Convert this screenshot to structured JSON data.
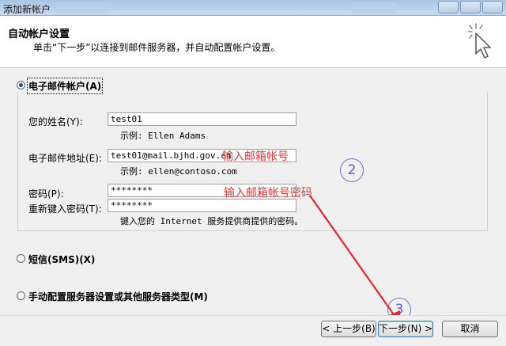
{
  "window": {
    "title": "添加新帐户"
  },
  "header": {
    "title": "自动帐户设置",
    "subtitle": "单击“下一步”以连接到邮件服务器，并自动配置帐户设置。"
  },
  "options": {
    "email": {
      "label": "电子邮件帐户(A)",
      "selected": true
    },
    "sms": {
      "label": "短信(SMS)(X)",
      "selected": false
    },
    "manual": {
      "label": "手动配置服务器设置或其他服务器类型(M)",
      "selected": false
    }
  },
  "form": {
    "name_label": "您的姓名(Y):",
    "name_value": "test01",
    "name_hint": "示例: Ellen Adams",
    "email_label": "电子邮件地址(E):",
    "email_value": "test01@mail.bjhd.gov.cn",
    "email_hint": "示例: ellen@contoso.com",
    "password_label": "密码(P):",
    "password_value": "********",
    "retype_label": "重新键入密码(T):",
    "retype_value": "********",
    "password_hint": "键入您的 Internet 服务提供商提供的密码。"
  },
  "annotations": {
    "email_note": "输入邮箱帐号",
    "password_note": "输入邮箱帐号密码",
    "step2": "2",
    "step3": "3",
    "arrow_color": "#e8262b"
  },
  "buttons": {
    "back": "< 上一步(B)",
    "next": "下一步(N) >",
    "cancel": "取消"
  }
}
